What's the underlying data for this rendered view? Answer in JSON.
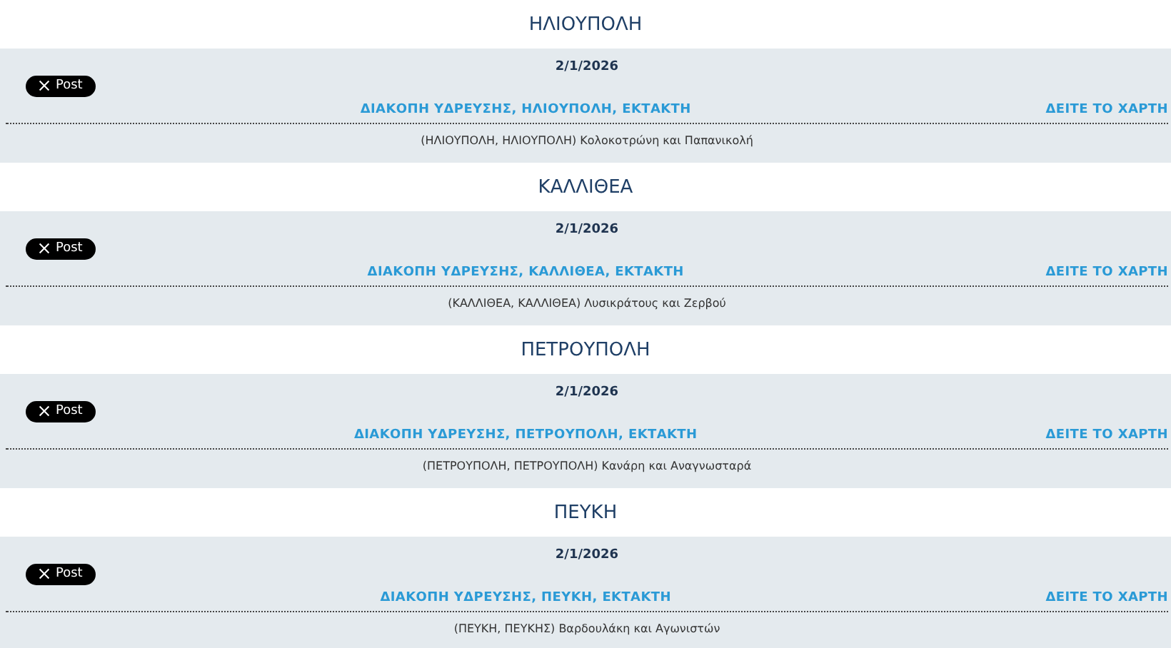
{
  "sections": [
    {
      "heading": "ΗΛΙΟΥΠΟΛΗ",
      "date": "2/1/2026",
      "post_button": "Post",
      "title": "ΔΙΑΚΟΠΗ ΥΔΡΕΥΣΗΣ, ΗΛΙΟΥΠΟΛΗ, ΕΚΤΑΚΤΗ",
      "map_link": "ΔΕΙΤΕ ΤΟ ΧΑΡΤΗ",
      "address": "(ΗΛΙΟΥΠΟΛΗ, ΗΛΙΟΥΠΟΛΗ) Κολοκοτρώνη και Παπανικολή"
    },
    {
      "heading": "ΚΑΛΛΙΘΕΑ",
      "date": "2/1/2026",
      "post_button": "Post",
      "title": "ΔΙΑΚΟΠΗ ΥΔΡΕΥΣΗΣ, ΚΑΛΛΙΘΕΑ, ΕΚΤΑΚΤΗ",
      "map_link": "ΔΕΙΤΕ ΤΟ ΧΑΡΤΗ",
      "address": "(ΚΑΛΛΙΘΕΑ, ΚΑΛΛΙΘΕΑ) Λυσικράτους και Ζερβού"
    },
    {
      "heading": "ΠΕΤΡΟΥΠΟΛΗ",
      "date": "2/1/2026",
      "post_button": "Post",
      "title": "ΔΙΑΚΟΠΗ ΥΔΡΕΥΣΗΣ, ΠΕΤΡΟΥΠΟΛΗ, ΕΚΤΑΚΤΗ",
      "map_link": "ΔΕΙΤΕ ΤΟ ΧΑΡΤΗ",
      "address": "(ΠΕΤΡΟΥΠΟΛΗ, ΠΕΤΡΟΥΠΟΛΗ) Κανάρη και Αναγνωσταρά"
    },
    {
      "heading": "ΠΕΥΚΗ",
      "date": "2/1/2026",
      "post_button": "Post",
      "title": "ΔΙΑΚΟΠΗ ΥΔΡΕΥΣΗΣ, ΠΕΥΚΗ, ΕΚΤΑΚΤΗ",
      "map_link": "ΔΕΙΤΕ ΤΟ ΧΑΡΤΗ",
      "address": "(ΠΕΥΚΗ, ΠΕΥΚΗΣ) Βαρδουλάκη και Αγωνιστών"
    }
  ]
}
